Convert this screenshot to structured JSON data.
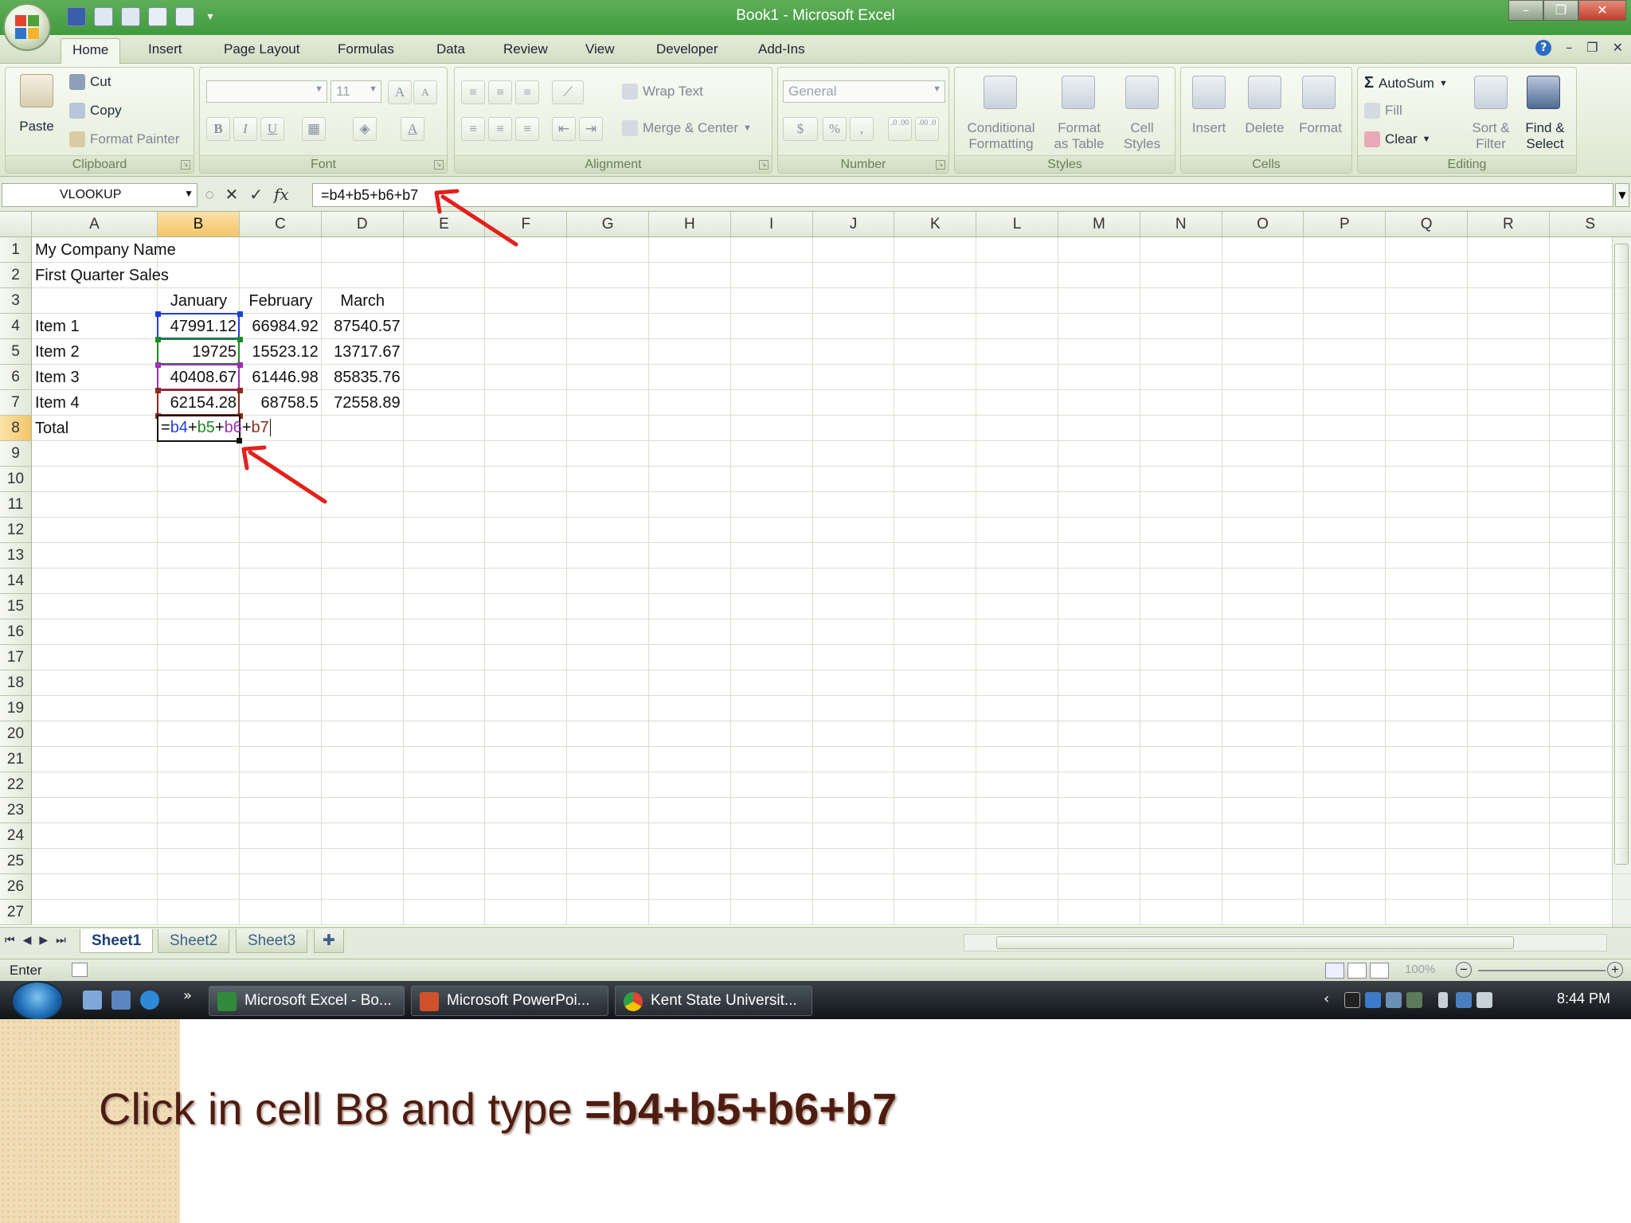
{
  "window": {
    "title": "Book1 - Microsoft Excel"
  },
  "ribbon_tabs": [
    "Home",
    "Insert",
    "Page Layout",
    "Formulas",
    "Data",
    "Review",
    "View",
    "Developer",
    "Add-Ins"
  ],
  "ribbon": {
    "clipboard": {
      "label": "Clipboard",
      "paste": "Paste",
      "cut": "Cut",
      "copy": "Copy",
      "format_painter": "Format Painter"
    },
    "font": {
      "label": "Font",
      "font_name": "",
      "font_size": "11",
      "bold": "B",
      "italic": "I",
      "underline": "U",
      "grow": "A",
      "shrink": "A"
    },
    "alignment": {
      "label": "Alignment",
      "wrap_text": "Wrap Text",
      "merge_center": "Merge & Center"
    },
    "number": {
      "label": "Number",
      "format": "General",
      "currency": "$",
      "percent": "%",
      "comma": ",",
      "inc_decimal": ".0 .00",
      "dec_decimal": ".00 .0"
    },
    "styles": {
      "label": "Styles",
      "conditional_1": "Conditional",
      "conditional_2": "Formatting",
      "format_table_1": "Format",
      "format_table_2": "as Table",
      "cell_styles_1": "Cell",
      "cell_styles_2": "Styles"
    },
    "cells": {
      "label": "Cells",
      "insert": "Insert",
      "delete": "Delete",
      "format": "Format"
    },
    "editing": {
      "label": "Editing",
      "autosum": "AutoSum",
      "fill": "Fill",
      "clear": "Clear",
      "sort_1": "Sort &",
      "sort_2": "Filter",
      "find_1": "Find &",
      "find_2": "Select"
    }
  },
  "formula_bar": {
    "name_box": "VLOOKUP",
    "cancel": "✕",
    "enter": "✓",
    "fx": "fx",
    "formula": "=b4+b5+b6+b7"
  },
  "grid": {
    "columns": [
      "A",
      "B",
      "C",
      "D",
      "E",
      "F",
      "G",
      "H",
      "I",
      "J",
      "K",
      "L",
      "M",
      "N",
      "O",
      "P",
      "Q",
      "R",
      "S"
    ],
    "rows": [
      "1",
      "2",
      "3",
      "4",
      "5",
      "6",
      "7",
      "8",
      "9",
      "10",
      "11",
      "12",
      "13",
      "14",
      "15",
      "16",
      "17",
      "18",
      "19",
      "20",
      "21",
      "22",
      "23",
      "24",
      "25",
      "26",
      "27"
    ],
    "cells": {
      "A1": "My Company Name",
      "A2": "First Quarter Sales",
      "B3": "January",
      "C3": "February",
      "D3": "March",
      "A4": "Item 1",
      "B4": "47991.12",
      "C4": "66984.92",
      "D4": "87540.57",
      "A5": "Item 2",
      "B5": "19725",
      "C5": "15523.12",
      "D5": "13717.67",
      "A6": "Item 3",
      "B6": "40408.67",
      "C6": "61446.98",
      "D6": "85835.76",
      "A7": "Item 4",
      "B7": "62154.28",
      "C7": "68758.5",
      "D7": "72558.89",
      "A8": "Total"
    },
    "editing_cell": {
      "ref": "B8",
      "parts": [
        {
          "text": "=",
          "color": "#111111"
        },
        {
          "text": "b4",
          "color": "#1f3fd8"
        },
        {
          "text": "+",
          "color": "#111111"
        },
        {
          "text": "b5",
          "color": "#1c8a24"
        },
        {
          "text": "+",
          "color": "#111111"
        },
        {
          "text": "b6",
          "color": "#9b2fb5"
        },
        {
          "text": "+",
          "color": "#111111"
        },
        {
          "text": "b7",
          "color": "#8b2a1c"
        }
      ]
    },
    "ref_colors": {
      "b4": "#1f3fd8",
      "b5": "#1c8a24",
      "b6": "#9b2fb5",
      "b7": "#8b2a1c"
    },
    "active_column": "B",
    "active_row": "8"
  },
  "sheet_tabs": [
    "Sheet1",
    "Sheet2",
    "Sheet3"
  ],
  "status": {
    "mode": "Enter",
    "zoom": "100%"
  },
  "taskbar": {
    "tasks": [
      "Microsoft Excel - Bo...",
      "Microsoft PowerPoi...",
      "Kent State Universit..."
    ],
    "more": "»",
    "clock": "8:44 PM"
  },
  "caption": {
    "prefix": "Click in cell B8 and type ",
    "formula": "=b4+b5+b6+b7"
  },
  "colors": {
    "title_bar": "#4aa346",
    "accent_arrow": "#e3201b",
    "caption_text": "#4e1c10"
  }
}
